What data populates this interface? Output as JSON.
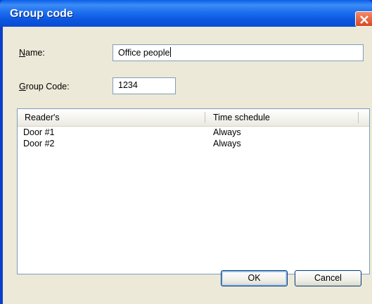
{
  "window": {
    "title": "Group code"
  },
  "form": {
    "name_label_u": "N",
    "name_label_rest": "ame:",
    "name_value": "Office people",
    "code_label_u": "G",
    "code_label_rest": "roup Code:",
    "code_value": "1234"
  },
  "list": {
    "columns": [
      "Reader's",
      "Time schedule"
    ],
    "rows": [
      {
        "reader": "Door #1",
        "schedule": "Always"
      },
      {
        "reader": "Door #2",
        "schedule": "Always"
      }
    ]
  },
  "buttons": {
    "ok": "OK",
    "cancel": "Cancel"
  },
  "icons": {
    "close": "close-icon"
  },
  "colors": {
    "titlebar": "#0a5ee8",
    "close": "#d84a25",
    "client": "#ece9d8"
  }
}
